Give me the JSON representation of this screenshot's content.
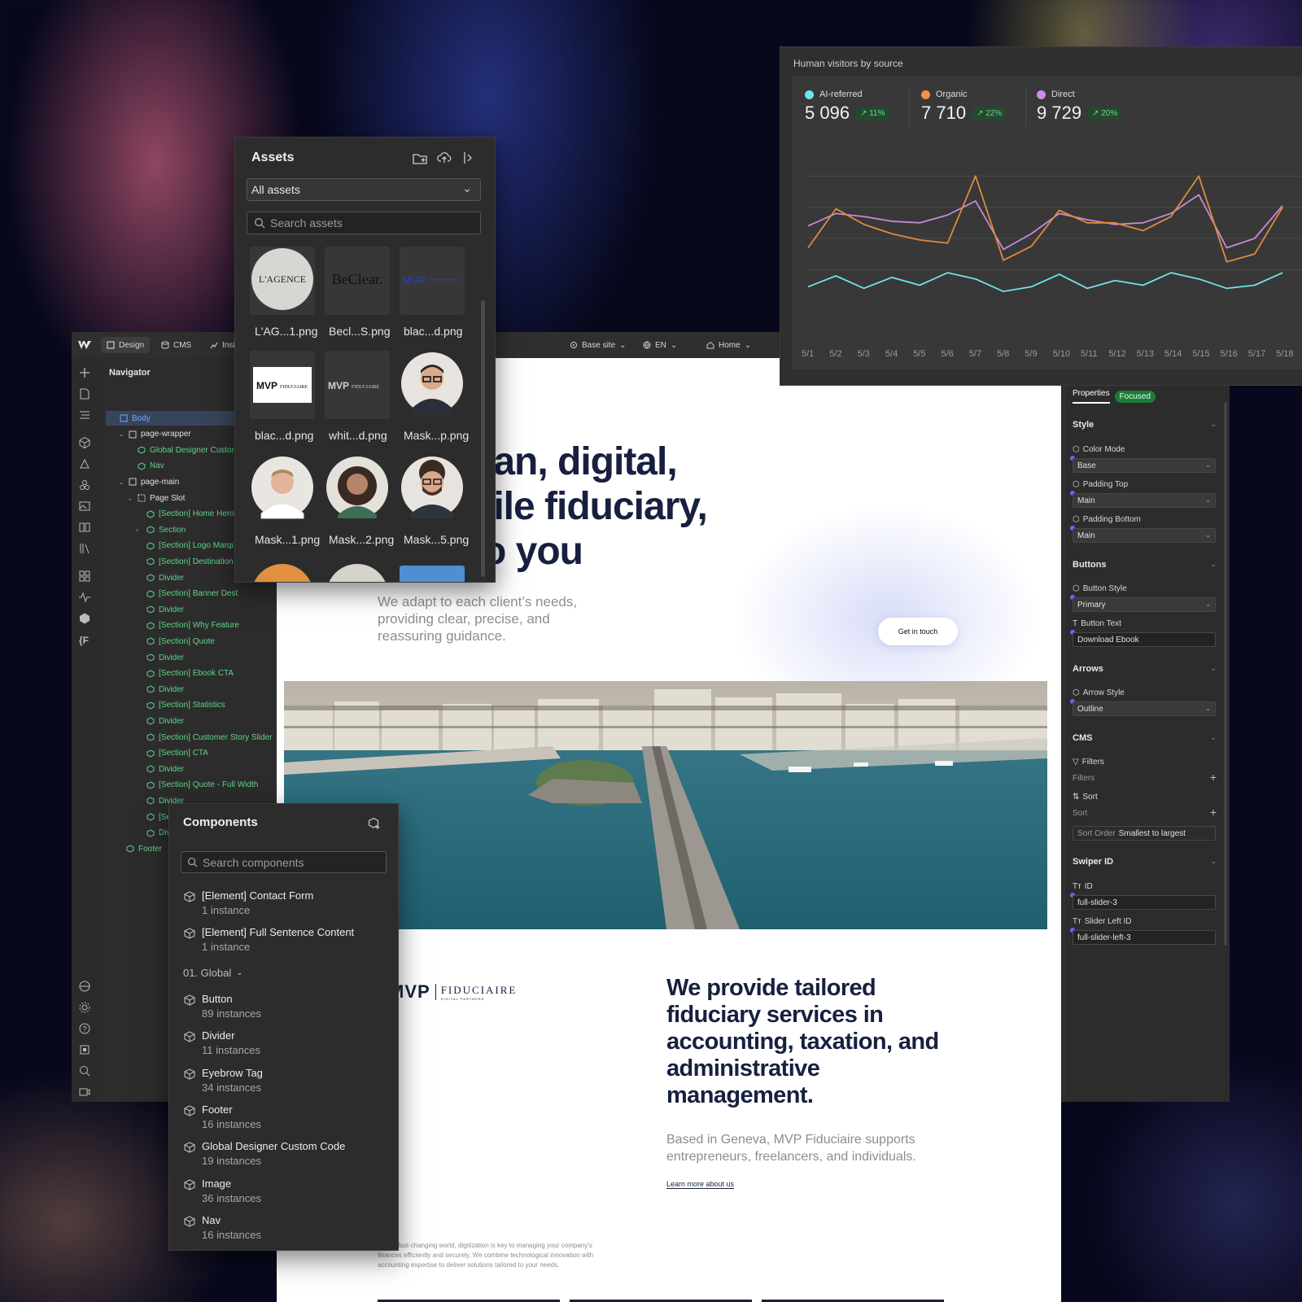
{
  "topbar": {
    "tabs": [
      {
        "label": "Design",
        "icon": "design-icon"
      },
      {
        "label": "CMS",
        "icon": "database-icon"
      },
      {
        "label": "Insi",
        "icon": "chart-icon"
      }
    ],
    "site": "Base site",
    "locale": "EN",
    "page": "Home"
  },
  "navigator": {
    "title": "Navigator",
    "items": [
      {
        "label": "Body",
        "type": "element"
      },
      {
        "label": "page-wrapper",
        "type": "element"
      },
      {
        "label": "Global Designer Custom C",
        "type": "component"
      },
      {
        "label": "Nav",
        "type": "component"
      },
      {
        "label": "page-main",
        "type": "element"
      },
      {
        "label": "Page Slot",
        "type": "slot"
      },
      {
        "label": "[Section] Home Hero",
        "type": "component"
      },
      {
        "label": "Section",
        "type": "component"
      },
      {
        "label": "[Section] Logo Marqu",
        "type": "component"
      },
      {
        "label": "[Section] Destination",
        "type": "component"
      },
      {
        "label": "Divider",
        "type": "component"
      },
      {
        "label": "[Section] Banner Dest",
        "type": "component"
      },
      {
        "label": "Divider",
        "type": "component"
      },
      {
        "label": "[Section] Why Feature",
        "type": "component"
      },
      {
        "label": "[Section] Quote",
        "type": "component"
      },
      {
        "label": "Divider",
        "type": "component"
      },
      {
        "label": "[Section] Ebook CTA",
        "type": "component"
      },
      {
        "label": "Divider",
        "type": "component"
      },
      {
        "label": "[Section] Statistics",
        "type": "component"
      },
      {
        "label": "Divider",
        "type": "component"
      },
      {
        "label": "[Section] Customer Story Slider",
        "type": "component"
      },
      {
        "label": "[Section] CTA",
        "type": "component"
      },
      {
        "label": "Divider",
        "type": "component"
      },
      {
        "label": "[Section] Quote - Full Width",
        "type": "component"
      },
      {
        "label": "Divider",
        "type": "component"
      },
      {
        "label": "[Section] CTA Slider",
        "type": "component"
      },
      {
        "label": "Divi",
        "type": "component"
      },
      {
        "label": "Footer",
        "type": "component"
      }
    ]
  },
  "assets": {
    "title": "Assets",
    "filter": "All assets",
    "search_placeholder": "Search assets",
    "items": [
      {
        "name": "L'AG...1.png",
        "thumb": "lagence-logo"
      },
      {
        "name": "Becl...S.png",
        "thumb": "beclear-logo"
      },
      {
        "name": "blac...d.png",
        "thumb": "mvp-logo-dark"
      },
      {
        "name": "blac...d.png",
        "thumb": "mvp-logo-white-bg"
      },
      {
        "name": "whit...d.png",
        "thumb": "mvp-logo-white"
      },
      {
        "name": "Mask...p.png",
        "thumb": "portrait-glasses"
      },
      {
        "name": "Mask...1.png",
        "thumb": "portrait-man"
      },
      {
        "name": "Mask...2.png",
        "thumb": "portrait-woman"
      },
      {
        "name": "Mask...5.png",
        "thumb": "portrait-beard"
      }
    ],
    "thumb_text": {
      "lagence": "L'AGENCE",
      "beclear": "BeClear.",
      "mvp": "MVP",
      "fiduciaire": "FIDUCIAIRE"
    }
  },
  "components": {
    "title": "Components",
    "search_placeholder": "Search components",
    "group": "01. Global",
    "top_items": [
      {
        "name": "[Element] Contact Form",
        "count": "1 instance"
      },
      {
        "name": "[Element] Full Sentence Content",
        "count": "1 instance"
      }
    ],
    "items": [
      {
        "name": "Button",
        "count": "89 instances"
      },
      {
        "name": "Divider",
        "count": "11 instances"
      },
      {
        "name": "Eyebrow Tag",
        "count": "34 instances"
      },
      {
        "name": "Footer",
        "count": "16 instances"
      },
      {
        "name": "Global Designer Custom Code",
        "count": "19 instances"
      },
      {
        "name": "Image",
        "count": "36 instances"
      },
      {
        "name": "Nav",
        "count": "16 instances"
      }
    ]
  },
  "canvas": {
    "hero_lines": [
      "nan, digital,",
      "gile fiduciary,",
      "to you"
    ],
    "hero_sub": "We adapt to each client’s needs, providing clear, precise, and reassuring guidance.",
    "cta": "Get in touch",
    "logo_mvp": "MVP",
    "logo_name": "FIDUCIAIRE",
    "logo_tag": "DIGITAL PARTNERS",
    "heading2": "We provide tailored fiduciary services in accounting, taxation, and administrative management.",
    "para2": "Based in Geneva, MVP Fiduciaire supports entrepreneurs, freelancers, and individuals.",
    "learn_link": "Learn more about us",
    "small_text": "oday’s fast-changing world, digitization is key to managing your company’s finances efficiently and securely. We combine technological innovation with accounting expertise to deliver solutions tailored to your needs."
  },
  "properties": {
    "tab": "Properties",
    "badge": "Focused",
    "style": {
      "title": "Style",
      "color_mode_label": "Color Mode",
      "color_mode": "Base",
      "padding_top_label": "Padding Top",
      "padding_top": "Main",
      "padding_bottom_label": "Padding Bottom",
      "padding_bottom": "Main"
    },
    "buttons": {
      "title": "Buttons",
      "button_style_label": "Button Style",
      "button_style": "Primary",
      "button_text_label": "Button Text",
      "button_text": "Download Ebook"
    },
    "arrows": {
      "title": "Arrows",
      "arrow_style_label": "Arrow Style",
      "arrow_style": "Outline"
    },
    "cms": {
      "title": "CMS",
      "filters_label": "Filters",
      "filters_dim": "Filters",
      "sort_label": "Sort",
      "sort_dim": "Sort",
      "sort_order_label": "Sort Order",
      "sort_order": "Smallest to largest"
    },
    "swiper": {
      "title": "Swiper ID",
      "id_label": "ID",
      "id": "full-slider-3",
      "left_label": "Slider Left ID",
      "left_id": "full-slider-left-3"
    }
  },
  "analytics": {
    "title": "Human visitors by source",
    "sources": [
      {
        "name": "AI-referred",
        "value": "5 096",
        "change": "↗ 11%",
        "color": "#6fe3e8"
      },
      {
        "name": "Organic",
        "value": "7 710",
        "change": "↗ 22%",
        "color": "#f0904a"
      },
      {
        "name": "Direct",
        "value": "9 729",
        "change": "↗ 20%",
        "color": "#d18be6"
      }
    ]
  },
  "chart_data": {
    "type": "line",
    "x": [
      "5/1",
      "5/2",
      "5/3",
      "5/4",
      "5/5",
      "5/6",
      "5/7",
      "5/8",
      "5/9",
      "5/10",
      "5/11",
      "5/12",
      "5/13",
      "5/14",
      "5/15",
      "5/16",
      "5/17",
      "5/18"
    ],
    "series": [
      {
        "name": "Direct",
        "color": "#c78ad9",
        "values": [
          6.8,
          7.6,
          7.4,
          7.1,
          7.0,
          7.5,
          8.4,
          5.3,
          6.3,
          7.6,
          7.2,
          6.9,
          7.0,
          7.6,
          8.8,
          5.4,
          6.0,
          8.1
        ]
      },
      {
        "name": "Organic",
        "color": "#e08a3d",
        "values": [
          5.4,
          7.9,
          6.9,
          6.3,
          5.9,
          5.7,
          10.0,
          4.6,
          5.5,
          7.8,
          7.0,
          7.0,
          6.5,
          7.4,
          10.0,
          4.5,
          5.0,
          8.0
        ]
      },
      {
        "name": "AI-referred",
        "color": "#6fe3e8",
        "values": [
          2.9,
          3.6,
          2.8,
          3.5,
          3.0,
          3.8,
          3.4,
          2.6,
          2.9,
          3.7,
          2.8,
          3.3,
          3.0,
          3.8,
          3.4,
          2.8,
          3.0,
          3.8
        ]
      }
    ],
    "ylim": [
      0,
      12
    ],
    "grid": true
  },
  "colors": {
    "accent": "#17203f",
    "nav_component": "#5fd48a",
    "selection": "#37455c"
  }
}
